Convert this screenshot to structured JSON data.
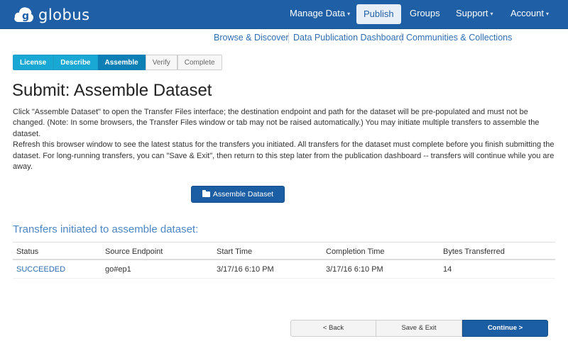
{
  "app": {
    "name": "globus"
  },
  "colors": {
    "navbar": "#1f5fa6",
    "accent": "#1c5ea4",
    "step_done": "#19a8d3",
    "step_current": "#0c7fb5",
    "subtitle": "#4e87c4"
  },
  "nav": {
    "items": [
      {
        "label": "Manage Data",
        "dropdown": true
      },
      {
        "label": "Publish",
        "active": true
      },
      {
        "label": "Groups"
      },
      {
        "label": "Support",
        "dropdown": true
      },
      {
        "label": "Account",
        "dropdown": true
      }
    ],
    "caret": "▼"
  },
  "subnav": [
    "Browse & Discover",
    "Data Publication Dashboard",
    "Communities & Collections"
  ],
  "steps": [
    "License",
    "Describe",
    "Assemble",
    "Verify",
    "Complete"
  ],
  "current_step": "Assemble",
  "page": {
    "title": "Submit: Assemble Dataset",
    "paragraph1": "Click \"Assemble Dataset\" to open the Transfer Files interface; the destination endpoint and path for the dataset will be pre-populated and must not be changed. (Note: In some browsers, the Transfer Files window or tab may not be raised automatically.) You may initiate multiple transfers to assemble the dataset.",
    "paragraph2": "Refresh this browser window to see the latest status for the transfers you initiated. All transfers for the dataset must complete before you finish submitting the dataset. For long-running transfers, you can \"Save & Exit\", then return to this step later from the publication dashboard -- transfers will continue while you are away.",
    "assemble_button": "Assemble Dataset",
    "transfers_title": "Transfers initiated to assemble dataset:"
  },
  "table": {
    "headers": [
      "Status",
      "Source Endpoint",
      "Start Time",
      "Completion Time",
      "Bytes Transferred"
    ],
    "rows": [
      [
        "SUCCEEDED",
        "go#ep1",
        "3/17/16 6:10 PM",
        "3/17/16 6:10 PM",
        "14"
      ]
    ]
  },
  "footer": {
    "back": "< Back",
    "save": "Save & Exit",
    "continue": "Continue >"
  }
}
